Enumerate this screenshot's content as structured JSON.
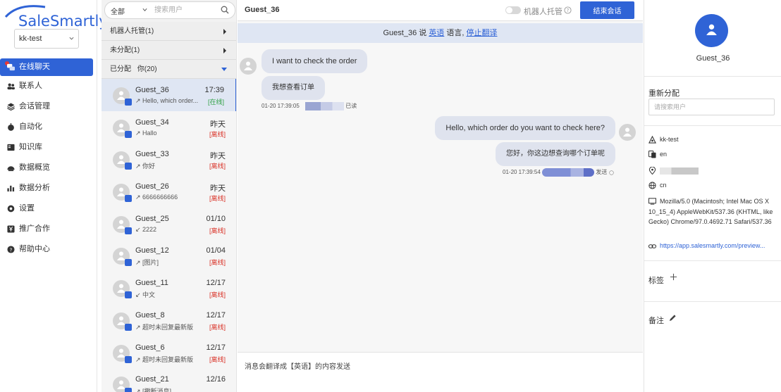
{
  "brand": {
    "logo_text": "SaleSmartly",
    "brand_color": "#2f63d6"
  },
  "workspace": {
    "name": "kk-test"
  },
  "nav": {
    "items": [
      {
        "label": "在线聊天",
        "icon": "chat-bubbles-icon",
        "active": true
      },
      {
        "label": "联系人",
        "icon": "contacts-icon"
      },
      {
        "label": "会话管理",
        "icon": "layers-icon"
      },
      {
        "label": "自动化",
        "icon": "robot-icon"
      },
      {
        "label": "知识库",
        "icon": "book-icon"
      },
      {
        "label": "数据概览",
        "icon": "gauge-icon"
      },
      {
        "label": "数据分析",
        "icon": "bar-chart-icon"
      },
      {
        "label": "设置",
        "icon": "settings-icon"
      },
      {
        "label": "推广合作",
        "icon": "yen-icon"
      },
      {
        "label": "帮助中心",
        "icon": "help-circle-icon"
      }
    ]
  },
  "search": {
    "filter_label": "全部",
    "placeholder": "搜索用户"
  },
  "groups": {
    "bot": "机器人托管(1)",
    "unassigned": "未分配(1)",
    "assigned": "已分配",
    "assigned_you": "你(20)"
  },
  "conversations": [
    {
      "name": "Guest_36",
      "time": "17:39",
      "preview": "↗ Hello, which order...",
      "status": "[在线]",
      "online": true,
      "active": true
    },
    {
      "name": "Guest_34",
      "time": "昨天",
      "preview": "↗ Hallo",
      "status": "[离线]",
      "online": false
    },
    {
      "name": "Guest_33",
      "time": "昨天",
      "preview": "↗ 你好",
      "status": "[离线]",
      "online": false
    },
    {
      "name": "Guest_26",
      "time": "昨天",
      "preview": "↗ 6666666666",
      "status": "[离线]",
      "online": false
    },
    {
      "name": "Guest_25",
      "time": "01/10",
      "preview": "↙ 2222",
      "status": "[离线]",
      "online": false
    },
    {
      "name": "Guest_12",
      "time": "01/04",
      "preview": "↗ [图片]",
      "status": "[离线]",
      "online": false
    },
    {
      "name": "Guest_11",
      "time": "12/17",
      "preview": "↙ 中文",
      "status": "[离线]",
      "online": false
    },
    {
      "name": "Guest_8",
      "time": "12/17",
      "preview": "↗ 超时未回复最新版",
      "status": "[离线]",
      "online": false
    },
    {
      "name": "Guest_6",
      "time": "12/17",
      "preview": "↗ 超时未回复最新版",
      "status": "[离线]",
      "online": false
    },
    {
      "name": "Guest_21",
      "time": "12/16",
      "preview": "↗ [撤断消息]",
      "status": "",
      "online": false
    }
  ],
  "chat": {
    "title": "Guest_36",
    "bot_toggle_label": "机器人托管",
    "end_button": "结束会话",
    "translate_prefix": "Guest_36 说",
    "translate_lang": "英语",
    "translate_mid": "语言,",
    "translate_stop": "停止翻译",
    "messages": [
      {
        "from": "guest",
        "text": "I want to check the order",
        "translation": "我想查看订单",
        "time": "01-20 17:39:05",
        "status": "已读"
      },
      {
        "from": "agent",
        "text": "Hello, which order do you want to check here?",
        "translation": "您好，你这边想查询哪个订单呢",
        "time": "01-20 17:39:54",
        "status": "发送"
      }
    ],
    "footer_note": "消息会翻译成【英语】的内容发送"
  },
  "info": {
    "name": "Guest_36",
    "reassign_label": "重新分配",
    "reassign_placeholder": "请搜索用户",
    "workspace": "kk-test",
    "language": "en",
    "region": "cn",
    "user_agent": "Mozilla/5.0 (Macintosh; Intel Mac OS X 10_15_4) AppleWebKit/537.36 (KHTML, like Gecko) Chrome/97.0.4692.71 Safari/537.36",
    "url": "https://app.salesmartly.com/preview...",
    "tags_label": "标签",
    "notes_label": "备注"
  }
}
